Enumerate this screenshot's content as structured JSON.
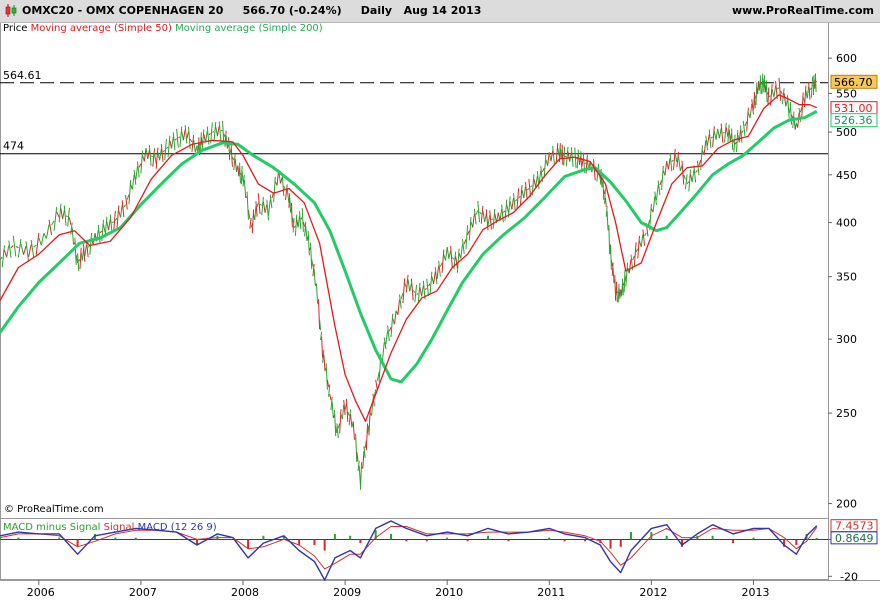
{
  "header": {
    "ticker": "OMXC20 - OMX COPENHAGEN 20",
    "price": "566.70 (-0.24%)",
    "period": "Daily",
    "date": "Aug 14 2013",
    "site": "www.ProRealTime.com"
  },
  "legend": {
    "price_label": "Price",
    "ma50_label": "Moving average (Simple 50)",
    "ma200_label": "Moving average (Simple 200)"
  },
  "copyright": "© ProRealTime.com",
  "macd_legend": {
    "hist_label": "MACD minus Signal",
    "signal_label": "Signal",
    "macd_label": "MACD (12 26 9)"
  },
  "colors": {
    "price_up": "#2ca02c",
    "price_down": "#d62728",
    "ma50": "#e31a1c",
    "ma200": "#22cc66",
    "macd": "#3333aa",
    "signal": "#cc3333",
    "hline": "#000000"
  },
  "chart_data": {
    "type": "line",
    "log_scale": true,
    "y_ticks": [
      200,
      250,
      300,
      350,
      400,
      450,
      500,
      550,
      600
    ],
    "y_range": [
      193,
      640
    ],
    "x_labels": [
      "2006",
      "2007",
      "2008",
      "2009",
      "2010",
      "2011",
      "2012",
      "2013"
    ],
    "x_range": [
      2005.62,
      2013.73
    ],
    "horizontal_lines": [
      {
        "label": "564.61",
        "value": 564.61,
        "style": "dashed"
      },
      {
        "label": "474",
        "value": 474,
        "style": "solid"
      }
    ],
    "last_values": [
      {
        "label": "566.70",
        "value": 566.7,
        "series": "price"
      },
      {
        "label": "531.00",
        "value": 531.0,
        "series": "ma50"
      },
      {
        "label": "526.36",
        "value": 526.36,
        "series": "ma200"
      }
    ],
    "series": [
      {
        "name": "Price",
        "points": [
          [
            2005.62,
            365
          ],
          [
            2005.75,
            378
          ],
          [
            2005.9,
            372
          ],
          [
            2006.05,
            385
          ],
          [
            2006.2,
            410
          ],
          [
            2006.3,
            405
          ],
          [
            2006.38,
            362
          ],
          [
            2006.45,
            372
          ],
          [
            2006.55,
            385
          ],
          [
            2006.65,
            395
          ],
          [
            2006.75,
            402
          ],
          [
            2006.85,
            418
          ],
          [
            2006.95,
            450
          ],
          [
            2007.05,
            475
          ],
          [
            2007.15,
            468
          ],
          [
            2007.25,
            480
          ],
          [
            2007.35,
            492
          ],
          [
            2007.45,
            498
          ],
          [
            2007.55,
            478
          ],
          [
            2007.6,
            490
          ],
          [
            2007.7,
            500
          ],
          [
            2007.8,
            502
          ],
          [
            2007.87,
            478
          ],
          [
            2007.95,
            455
          ],
          [
            2008.0,
            448
          ],
          [
            2008.08,
            395
          ],
          [
            2008.15,
            420
          ],
          [
            2008.25,
            412
          ],
          [
            2008.35,
            450
          ],
          [
            2008.45,
            425
          ],
          [
            2008.5,
            395
          ],
          [
            2008.58,
            405
          ],
          [
            2008.65,
            378
          ],
          [
            2008.72,
            340
          ],
          [
            2008.78,
            290
          ],
          [
            2008.85,
            262
          ],
          [
            2008.92,
            238
          ],
          [
            2009.0,
            255
          ],
          [
            2009.08,
            242
          ],
          [
            2009.15,
            212
          ],
          [
            2009.22,
            238
          ],
          [
            2009.3,
            265
          ],
          [
            2009.4,
            300
          ],
          [
            2009.5,
            318
          ],
          [
            2009.6,
            345
          ],
          [
            2009.7,
            335
          ],
          [
            2009.8,
            340
          ],
          [
            2009.9,
            352
          ],
          [
            2010.0,
            372
          ],
          [
            2010.1,
            362
          ],
          [
            2010.2,
            388
          ],
          [
            2010.3,
            412
          ],
          [
            2010.4,
            402
          ],
          [
            2010.5,
            405
          ],
          [
            2010.6,
            415
          ],
          [
            2010.7,
            425
          ],
          [
            2010.8,
            435
          ],
          [
            2010.9,
            445
          ],
          [
            2011.0,
            470
          ],
          [
            2011.1,
            476
          ],
          [
            2011.15,
            471
          ],
          [
            2011.25,
            470
          ],
          [
            2011.32,
            465
          ],
          [
            2011.4,
            460
          ],
          [
            2011.5,
            450
          ],
          [
            2011.55,
            425
          ],
          [
            2011.6,
            370
          ],
          [
            2011.65,
            338
          ],
          [
            2011.7,
            335
          ],
          [
            2011.75,
            350
          ],
          [
            2011.85,
            372
          ],
          [
            2011.95,
            390
          ],
          [
            2012.05,
            428
          ],
          [
            2012.15,
            460
          ],
          [
            2012.25,
            470
          ],
          [
            2012.35,
            440
          ],
          [
            2012.45,
            455
          ],
          [
            2012.55,
            490
          ],
          [
            2012.65,
            498
          ],
          [
            2012.75,
            500
          ],
          [
            2012.82,
            485
          ],
          [
            2012.9,
            502
          ],
          [
            2013.0,
            535
          ],
          [
            2013.05,
            560
          ],
          [
            2013.1,
            565
          ],
          [
            2013.15,
            545
          ],
          [
            2013.25,
            558
          ],
          [
            2013.35,
            530
          ],
          [
            2013.42,
            505
          ],
          [
            2013.5,
            545
          ],
          [
            2013.58,
            560
          ],
          [
            2013.62,
            566.7
          ]
        ]
      },
      {
        "name": "Moving average (Simple 50)",
        "points": [
          [
            2005.62,
            330
          ],
          [
            2005.8,
            358
          ],
          [
            2006.0,
            370
          ],
          [
            2006.2,
            388
          ],
          [
            2006.35,
            392
          ],
          [
            2006.5,
            378
          ],
          [
            2006.7,
            382
          ],
          [
            2006.9,
            405
          ],
          [
            2007.1,
            445
          ],
          [
            2007.3,
            472
          ],
          [
            2007.5,
            485
          ],
          [
            2007.7,
            490
          ],
          [
            2007.9,
            488
          ],
          [
            2008.0,
            472
          ],
          [
            2008.15,
            440
          ],
          [
            2008.3,
            430
          ],
          [
            2008.45,
            435
          ],
          [
            2008.6,
            420
          ],
          [
            2008.75,
            380
          ],
          [
            2008.9,
            310
          ],
          [
            2009.0,
            275
          ],
          [
            2009.1,
            258
          ],
          [
            2009.2,
            245
          ],
          [
            2009.3,
            262
          ],
          [
            2009.45,
            290
          ],
          [
            2009.6,
            315
          ],
          [
            2009.75,
            332
          ],
          [
            2009.9,
            338
          ],
          [
            2010.05,
            358
          ],
          [
            2010.2,
            370
          ],
          [
            2010.35,
            393
          ],
          [
            2010.5,
            402
          ],
          [
            2010.65,
            410
          ],
          [
            2010.8,
            426
          ],
          [
            2010.95,
            448
          ],
          [
            2011.1,
            468
          ],
          [
            2011.25,
            470
          ],
          [
            2011.4,
            465
          ],
          [
            2011.55,
            440
          ],
          [
            2011.65,
            400
          ],
          [
            2011.75,
            355
          ],
          [
            2011.9,
            362
          ],
          [
            2012.05,
            400
          ],
          [
            2012.2,
            440
          ],
          [
            2012.35,
            458
          ],
          [
            2012.5,
            460
          ],
          [
            2012.65,
            480
          ],
          [
            2012.8,
            490
          ],
          [
            2012.95,
            495
          ],
          [
            2013.1,
            530
          ],
          [
            2013.25,
            548
          ],
          [
            2013.35,
            542
          ],
          [
            2013.45,
            535
          ],
          [
            2013.55,
            535
          ],
          [
            2013.62,
            531
          ]
        ]
      },
      {
        "name": "Moving average (Simple 200)",
        "points": [
          [
            2005.62,
            305
          ],
          [
            2005.8,
            325
          ],
          [
            2006.0,
            345
          ],
          [
            2006.2,
            362
          ],
          [
            2006.4,
            380
          ],
          [
            2006.6,
            385
          ],
          [
            2006.8,
            395
          ],
          [
            2007.0,
            418
          ],
          [
            2007.2,
            440
          ],
          [
            2007.4,
            462
          ],
          [
            2007.6,
            478
          ],
          [
            2007.8,
            487
          ],
          [
            2007.95,
            485
          ],
          [
            2008.1,
            472
          ],
          [
            2008.3,
            458
          ],
          [
            2008.5,
            440
          ],
          [
            2008.7,
            420
          ],
          [
            2008.85,
            392
          ],
          [
            2009.0,
            355
          ],
          [
            2009.15,
            320
          ],
          [
            2009.3,
            292
          ],
          [
            2009.45,
            272
          ],
          [
            2009.55,
            270
          ],
          [
            2009.7,
            282
          ],
          [
            2009.85,
            300
          ],
          [
            2010.0,
            322
          ],
          [
            2010.15,
            345
          ],
          [
            2010.35,
            370
          ],
          [
            2010.55,
            388
          ],
          [
            2010.75,
            404
          ],
          [
            2010.95,
            425
          ],
          [
            2011.15,
            448
          ],
          [
            2011.35,
            456
          ],
          [
            2011.45,
            458
          ],
          [
            2011.6,
            442
          ],
          [
            2011.75,
            422
          ],
          [
            2011.9,
            400
          ],
          [
            2012.05,
            392
          ],
          [
            2012.15,
            395
          ],
          [
            2012.3,
            412
          ],
          [
            2012.45,
            430
          ],
          [
            2012.6,
            450
          ],
          [
            2012.75,
            462
          ],
          [
            2012.9,
            472
          ],
          [
            2013.05,
            488
          ],
          [
            2013.2,
            505
          ],
          [
            2013.35,
            515
          ],
          [
            2013.5,
            518
          ],
          [
            2013.62,
            526.36
          ]
        ]
      }
    ],
    "macd_panel": {
      "y_ticks": [
        0,
        -20
      ],
      "y_range": [
        -22,
        10
      ],
      "last_values": [
        {
          "label": "7.4573",
          "value": 7.4573,
          "series": "macd"
        },
        {
          "label": "0.8649",
          "value": 0.8649,
          "series": "histogram"
        }
      ],
      "macd": [
        [
          2005.62,
          2
        ],
        [
          2005.8,
          4
        ],
        [
          2006.0,
          3
        ],
        [
          2006.2,
          3
        ],
        [
          2006.38,
          -8
        ],
        [
          2006.55,
          2
        ],
        [
          2006.75,
          4
        ],
        [
          2006.95,
          6
        ],
        [
          2007.15,
          5
        ],
        [
          2007.35,
          4
        ],
        [
          2007.55,
          -3
        ],
        [
          2007.75,
          3
        ],
        [
          2007.9,
          1
        ],
        [
          2008.05,
          -10
        ],
        [
          2008.2,
          -2
        ],
        [
          2008.4,
          2
        ],
        [
          2008.55,
          -6
        ],
        [
          2008.7,
          -12
        ],
        [
          2008.8,
          -22
        ],
        [
          2008.9,
          -10
        ],
        [
          2009.05,
          -6
        ],
        [
          2009.15,
          -10
        ],
        [
          2009.3,
          6
        ],
        [
          2009.45,
          10
        ],
        [
          2009.6,
          6
        ],
        [
          2009.8,
          2
        ],
        [
          2010.0,
          4
        ],
        [
          2010.2,
          2
        ],
        [
          2010.4,
          6
        ],
        [
          2010.6,
          3
        ],
        [
          2010.8,
          4
        ],
        [
          2011.0,
          6
        ],
        [
          2011.15,
          3
        ],
        [
          2011.35,
          1
        ],
        [
          2011.5,
          -3
        ],
        [
          2011.6,
          -12
        ],
        [
          2011.7,
          -18
        ],
        [
          2011.8,
          -6
        ],
        [
          2012.0,
          6
        ],
        [
          2012.15,
          8
        ],
        [
          2012.3,
          -3
        ],
        [
          2012.45,
          3
        ],
        [
          2012.6,
          8
        ],
        [
          2012.8,
          3
        ],
        [
          2013.0,
          6
        ],
        [
          2013.15,
          6
        ],
        [
          2013.3,
          -3
        ],
        [
          2013.42,
          -8
        ],
        [
          2013.52,
          2
        ],
        [
          2013.62,
          7.4573
        ]
      ],
      "signal": [
        [
          2005.62,
          1
        ],
        [
          2005.8,
          3
        ],
        [
          2006.0,
          3
        ],
        [
          2006.2,
          2
        ],
        [
          2006.38,
          -4
        ],
        [
          2006.55,
          -1
        ],
        [
          2006.75,
          3
        ],
        [
          2006.95,
          5
        ],
        [
          2007.15,
          5
        ],
        [
          2007.35,
          4
        ],
        [
          2007.55,
          0
        ],
        [
          2007.75,
          1
        ],
        [
          2007.9,
          1
        ],
        [
          2008.05,
          -5
        ],
        [
          2008.2,
          -4
        ],
        [
          2008.4,
          0
        ],
        [
          2008.55,
          -3
        ],
        [
          2008.7,
          -9
        ],
        [
          2008.8,
          -16
        ],
        [
          2008.9,
          -13
        ],
        [
          2009.05,
          -8
        ],
        [
          2009.15,
          -8
        ],
        [
          2009.3,
          1
        ],
        [
          2009.45,
          7
        ],
        [
          2009.6,
          7
        ],
        [
          2009.8,
          3
        ],
        [
          2010.0,
          3
        ],
        [
          2010.2,
          3
        ],
        [
          2010.4,
          4
        ],
        [
          2010.6,
          4
        ],
        [
          2010.8,
          4
        ],
        [
          2011.0,
          5
        ],
        [
          2011.15,
          4
        ],
        [
          2011.35,
          2
        ],
        [
          2011.5,
          -1
        ],
        [
          2011.6,
          -7
        ],
        [
          2011.7,
          -14
        ],
        [
          2011.8,
          -10
        ],
        [
          2012.0,
          2
        ],
        [
          2012.15,
          6
        ],
        [
          2012.3,
          1
        ],
        [
          2012.45,
          1
        ],
        [
          2012.6,
          6
        ],
        [
          2012.8,
          5
        ],
        [
          2013.0,
          5
        ],
        [
          2013.15,
          6
        ],
        [
          2013.3,
          1
        ],
        [
          2013.42,
          -5
        ],
        [
          2013.52,
          -1
        ],
        [
          2013.62,
          6.59
        ]
      ]
    }
  }
}
